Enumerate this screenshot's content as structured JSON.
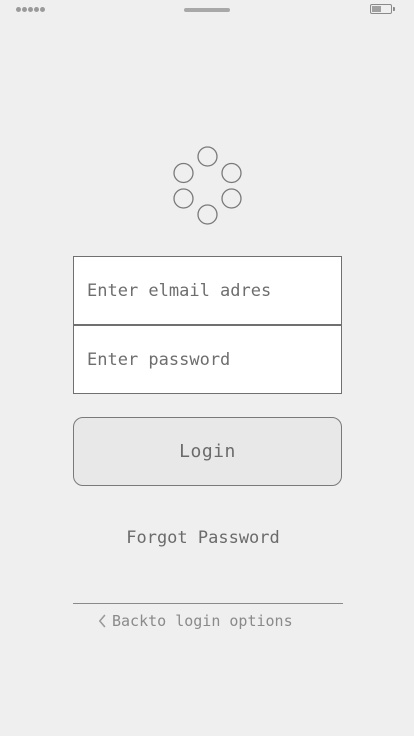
{
  "status_bar": {
    "signal_icon": "signal-dots-icon",
    "battery_icon": "battery-icon"
  },
  "logo": {
    "icon": "circle-ring-logo-icon"
  },
  "login_form": {
    "email_placeholder": "Enter elmail adres",
    "email_value": "",
    "password_placeholder": "Enter password",
    "password_value": "",
    "login_label": "Login"
  },
  "links": {
    "forgot_password": "Forgot Password",
    "back_to_login_options": "Backto login options",
    "back_icon": "chevron-left-icon"
  },
  "colors": {
    "background": "#efefef",
    "field_background": "#ffffff",
    "button_background": "#e8e8e8",
    "text": "#6b6b6b",
    "muted_text": "#8a8a8a",
    "border": "#707070"
  }
}
